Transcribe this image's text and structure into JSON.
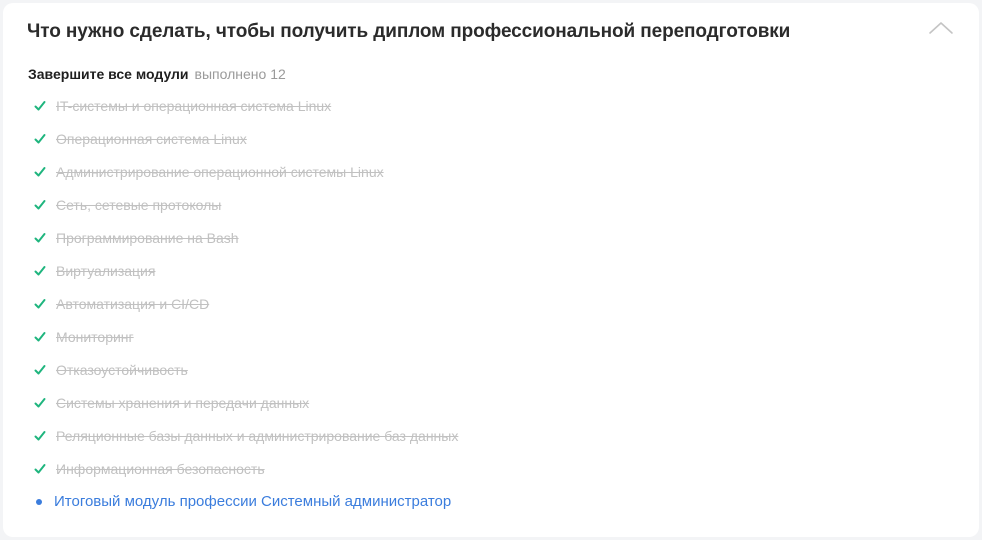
{
  "card": {
    "title": "Что нужно сделать, чтобы получить диплом профессиональной переподготовки"
  },
  "section": {
    "heading": "Завершите все модули",
    "completed_text": "выполнено 12"
  },
  "completed_modules": [
    {
      "label": "IT-системы и операционная система Linux"
    },
    {
      "label": "Операционная система Linux"
    },
    {
      "label": "Администрирование операционной системы Linux"
    },
    {
      "label": "Сеть, сетевые протоколы"
    },
    {
      "label": "Программирование на Bash"
    },
    {
      "label": "Виртуализация"
    },
    {
      "label": "Автоматизация и CI/CD"
    },
    {
      "label": "Мониторинг"
    },
    {
      "label": "Отказоустойчивость"
    },
    {
      "label": "Системы хранения и передачи данных"
    },
    {
      "label": "Реляционные базы данных и администрирование баз данных"
    },
    {
      "label": "Информационная безопасность"
    }
  ],
  "active_module": {
    "label": "Итоговый модуль профессии Системный администратор"
  },
  "colors": {
    "check": "#1fb57e",
    "link": "#3b7ddd",
    "done_text": "#c1c1c1"
  },
  "icons": {
    "collapse": "chevron-up-icon",
    "completed": "check-icon",
    "current": "dot-icon"
  }
}
